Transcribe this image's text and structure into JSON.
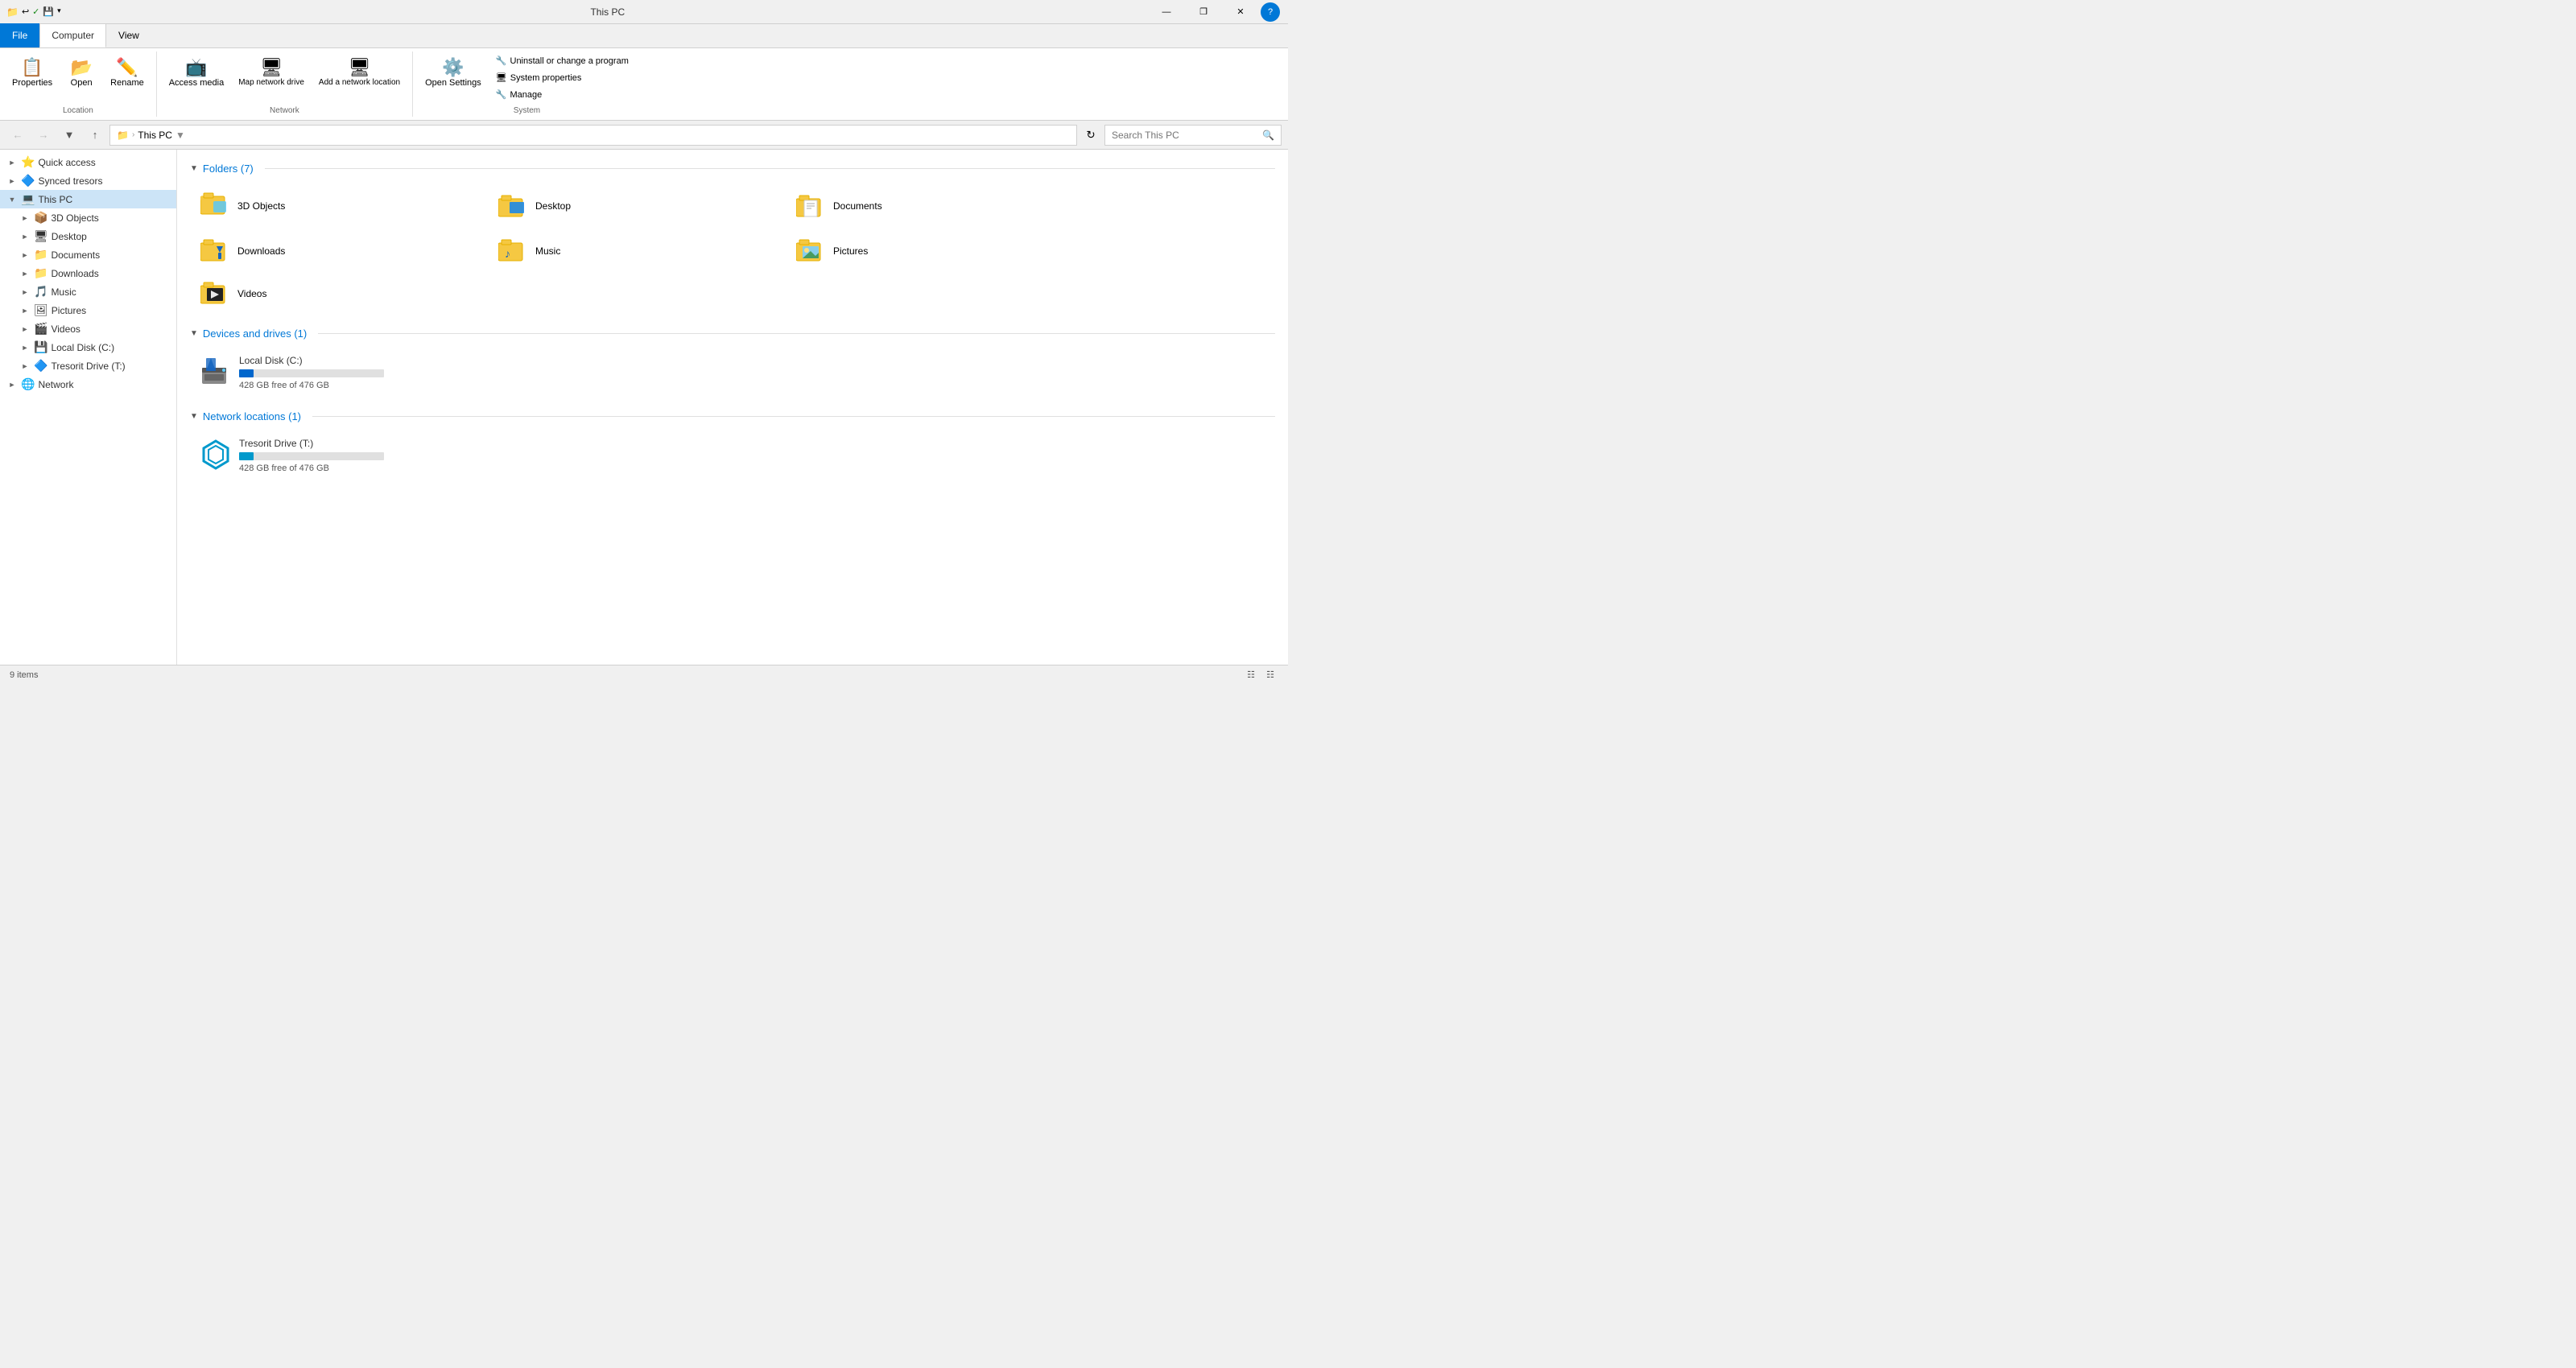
{
  "titlebar": {
    "title": "This PC",
    "min_label": "—",
    "max_label": "❐",
    "close_label": "✕",
    "help_label": "?"
  },
  "ribbon_tabs": {
    "file_label": "File",
    "computer_label": "Computer",
    "view_label": "View"
  },
  "ribbon_groups": {
    "location": {
      "label": "Location",
      "properties_label": "Properties",
      "open_label": "Open",
      "rename_label": "Rename"
    },
    "network": {
      "label": "Network",
      "access_media_label": "Access media",
      "map_network_label": "Map network drive",
      "add_network_label": "Add a network location"
    },
    "system": {
      "label": "System",
      "open_settings_label": "Open Settings",
      "uninstall_label": "Uninstall or change a program",
      "system_properties_label": "System properties",
      "manage_label": "Manage"
    }
  },
  "navbar": {
    "address_parts": [
      "This PC"
    ],
    "search_placeholder": "Search This PC"
  },
  "sidebar": {
    "items": [
      {
        "id": "quick-access",
        "label": "Quick access",
        "indent": 0,
        "expanded": false,
        "icon": "⭐"
      },
      {
        "id": "synced-tresors",
        "label": "Synced tresors",
        "indent": 0,
        "expanded": false,
        "icon": "🔷"
      },
      {
        "id": "this-pc",
        "label": "This PC",
        "indent": 0,
        "expanded": true,
        "icon": "💻",
        "selected": true
      },
      {
        "id": "3d-objects",
        "label": "3D Objects",
        "indent": 1,
        "expanded": false,
        "icon": "📦"
      },
      {
        "id": "desktop",
        "label": "Desktop",
        "indent": 1,
        "expanded": false,
        "icon": "🖥"
      },
      {
        "id": "documents",
        "label": "Documents",
        "indent": 1,
        "expanded": false,
        "icon": "📁"
      },
      {
        "id": "downloads",
        "label": "Downloads",
        "indent": 1,
        "expanded": false,
        "icon": "📁"
      },
      {
        "id": "music",
        "label": "Music",
        "indent": 1,
        "expanded": false,
        "icon": "🎵"
      },
      {
        "id": "pictures",
        "label": "Pictures",
        "indent": 1,
        "expanded": false,
        "icon": "🖼"
      },
      {
        "id": "videos",
        "label": "Videos",
        "indent": 1,
        "expanded": false,
        "icon": "🎬"
      },
      {
        "id": "local-disk",
        "label": "Local Disk (C:)",
        "indent": 1,
        "expanded": false,
        "icon": "💾"
      },
      {
        "id": "tresorit-drive",
        "label": "Tresorit Drive (T:)",
        "indent": 1,
        "expanded": false,
        "icon": "🔷"
      },
      {
        "id": "network",
        "label": "Network",
        "indent": 0,
        "expanded": false,
        "icon": "🌐"
      }
    ]
  },
  "content": {
    "folders_section": {
      "title": "Folders (7)",
      "items": [
        {
          "id": "3d-objects",
          "label": "3D Objects",
          "icon": "folder-3d"
        },
        {
          "id": "desktop",
          "label": "Desktop",
          "icon": "folder-desktop"
        },
        {
          "id": "documents",
          "label": "Documents",
          "icon": "folder-docs"
        },
        {
          "id": "downloads",
          "label": "Downloads",
          "icon": "folder-downloads"
        },
        {
          "id": "music",
          "label": "Music",
          "icon": "folder-music"
        },
        {
          "id": "pictures",
          "label": "Pictures",
          "icon": "folder-pictures"
        },
        {
          "id": "videos",
          "label": "Videos",
          "icon": "folder-videos"
        }
      ]
    },
    "drives_section": {
      "title": "Devices and drives (1)",
      "items": [
        {
          "id": "local-disk-c",
          "label": "Local Disk (C:)",
          "free_space": "428 GB free of 476 GB",
          "fill_percent": 10,
          "fill_color": "#06c"
        }
      ]
    },
    "network_section": {
      "title": "Network locations (1)",
      "items": [
        {
          "id": "tresorit-drive-t",
          "label": "Tresorit Drive (T:)",
          "free_space": "428 GB free of 476 GB",
          "fill_percent": 10,
          "fill_color": "#0099cc"
        }
      ]
    }
  },
  "statusbar": {
    "count_label": "9 items"
  }
}
